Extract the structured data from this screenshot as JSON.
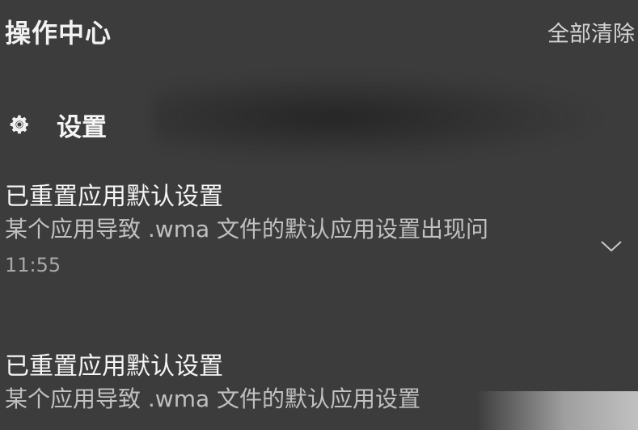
{
  "header": {
    "title": "操作中心",
    "clear_all": "全部清除"
  },
  "group": {
    "icon": "gear-icon",
    "title": "设置"
  },
  "notifications": [
    {
      "title": "已重置应用默认设置",
      "body": "某个应用导致 .wma 文件的默认应用设置出现问",
      "time": "11:55"
    },
    {
      "title": "已重置应用默认设置",
      "body": "某个应用导致 .wma 文件的默认应用设置"
    }
  ],
  "colors": {
    "background": "#3c3c3c",
    "title_text": "#f2f2f2",
    "body_text": "#c0c0c0"
  }
}
